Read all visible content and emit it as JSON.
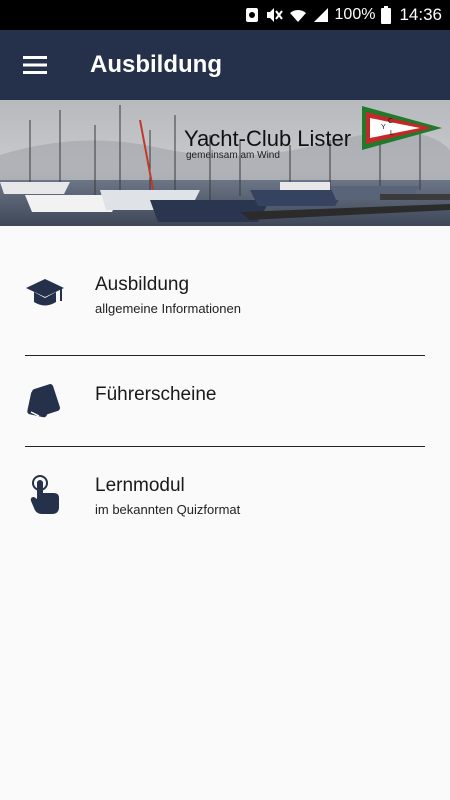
{
  "status_bar": {
    "battery": "100%",
    "time": "14:36"
  },
  "app_bar": {
    "title": "Ausbildung",
    "menu_icon": "hamburger-menu-icon"
  },
  "banner": {
    "club_name": "Yacht-Club Lister",
    "tagline": "gemeinsam am Wind",
    "burgee_letters": [
      "Y",
      "C",
      "L"
    ]
  },
  "menu": {
    "items": [
      {
        "title": "Ausbildung",
        "subtitle": "allgemeine Informationen",
        "icon": "graduation-cap-icon"
      },
      {
        "title": "Führerscheine",
        "subtitle": "",
        "icon": "license-cards-icon"
      },
      {
        "title": "Lernmodul",
        "subtitle": "im bekannten Quizformat",
        "icon": "touch-pointer-icon"
      }
    ]
  },
  "colors": {
    "app_bar": "#25304a",
    "icon": "#25304a",
    "background": "#fafafa"
  }
}
